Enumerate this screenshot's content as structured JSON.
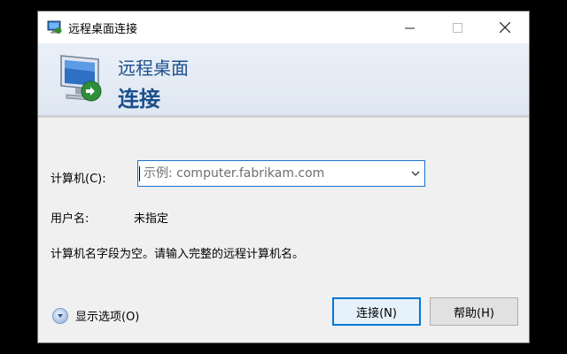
{
  "window": {
    "title": "远程桌面连接",
    "controls": {
      "minimize": "minimize-icon",
      "maximize": "maximize-icon",
      "close": "close-icon"
    }
  },
  "banner": {
    "line1": "远程桌面",
    "line2": "连接",
    "icon": "remote-desktop-monitor-icon"
  },
  "form": {
    "computer_label": "计算机(C):",
    "computer_value": "",
    "computer_placeholder": "示例: computer.fabrikam.com",
    "user_label": "用户名:",
    "user_value": "未指定",
    "message": "计算机名字段为空。请输入完整的远程计算机名。"
  },
  "footer": {
    "show_options": "显示选项(O)",
    "connect_button": "连接(N)",
    "help_button": "帮助(H)"
  },
  "colors": {
    "accent": "#0078d7",
    "banner_text": "#1a4f8b",
    "dialog_bg": "#f0f0f0"
  }
}
